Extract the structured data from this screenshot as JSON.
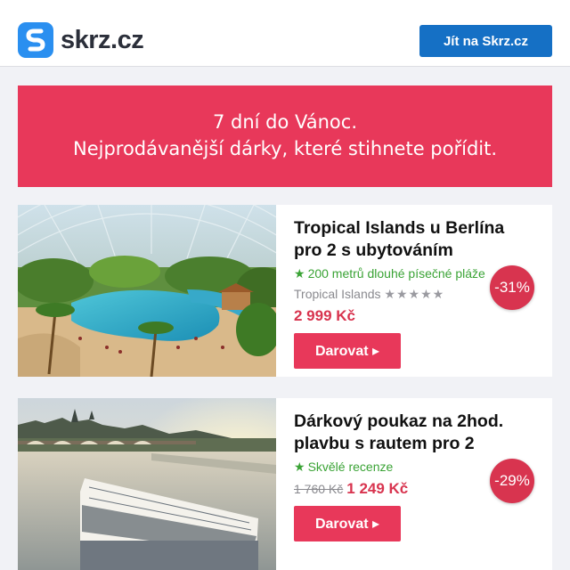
{
  "header": {
    "brand": "skrz.cz",
    "cta_label": "Jít na Skrz.cz"
  },
  "banner": {
    "line1": "7 dní do Vánoc.",
    "line2": "Nejprodávanější dárky, které stihnete pořídit."
  },
  "products": [
    {
      "title": "Tropical Islands u Berlína pro 2 s ubytováním",
      "feature": "200 metrů dlouhé písečné pláže",
      "provider": "Tropical Islands",
      "stars": "★★★★★",
      "price": "2 999 Kč",
      "discount": "-31%",
      "button_label": "Darovat ▸"
    },
    {
      "title": "Dárkový poukaz na 2hod. plavbu s rautem pro 2",
      "feature": "Skvělé recenze",
      "old_price": "1 760 Kč",
      "price": "1 249 Kč",
      "discount": "-29%",
      "button_label": "Darovat ▸"
    }
  ],
  "colors": {
    "brand_blue": "#2a8ff0",
    "cta_blue": "#1570c5",
    "accent_red": "#e8385a",
    "feature_green": "#3aa335"
  },
  "icons": {
    "logo": "skrz-s-logo-icon",
    "feature": "star-icon"
  }
}
